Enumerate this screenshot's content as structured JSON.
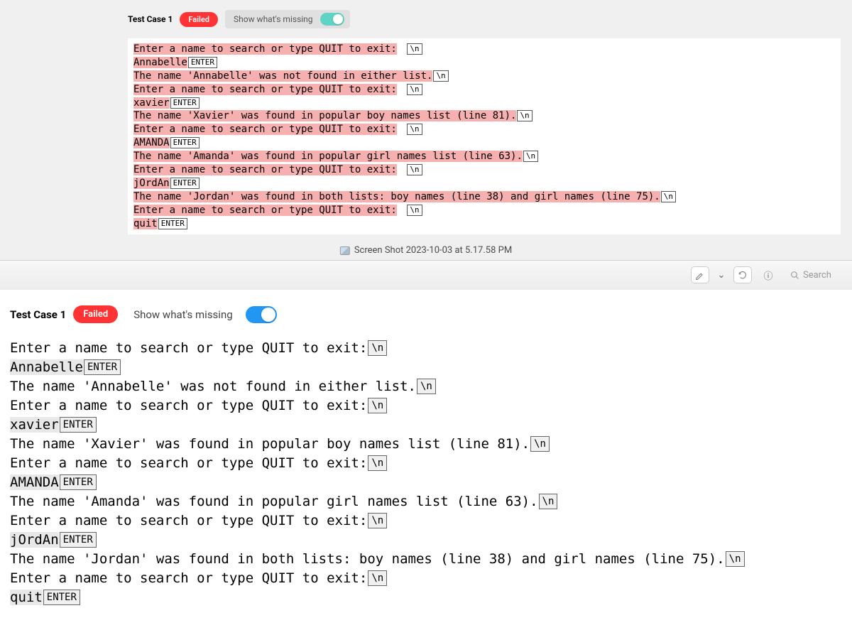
{
  "testCase": {
    "label": "Test Case 1",
    "status": "Failed",
    "showMissing": "Show what's missing"
  },
  "tokens": {
    "nl": "\\n",
    "enter": "ENTER"
  },
  "lines": {
    "prompt": "Enter a name to search or type QUIT to exit:",
    "in1": "Annabelle",
    "out1": "The name 'Annabelle' was not found in either list.",
    "in2": "xavier",
    "out2": "The name 'Xavier' was found in popular boy names list (line 81).",
    "in3": "AMANDA",
    "out3": "The name 'Amanda' was found in popular girl names list (line 63).",
    "in4": "jOrdAn",
    "out4": "The name 'Jordan' was found in both lists: boy names (line 38) and girl names (line 75).",
    "in5": "quit"
  },
  "file": {
    "title": "Screen Shot 2023-10-03 at 5.17.58 PM"
  },
  "toolbar": {
    "searchPlaceholder": "Search"
  }
}
